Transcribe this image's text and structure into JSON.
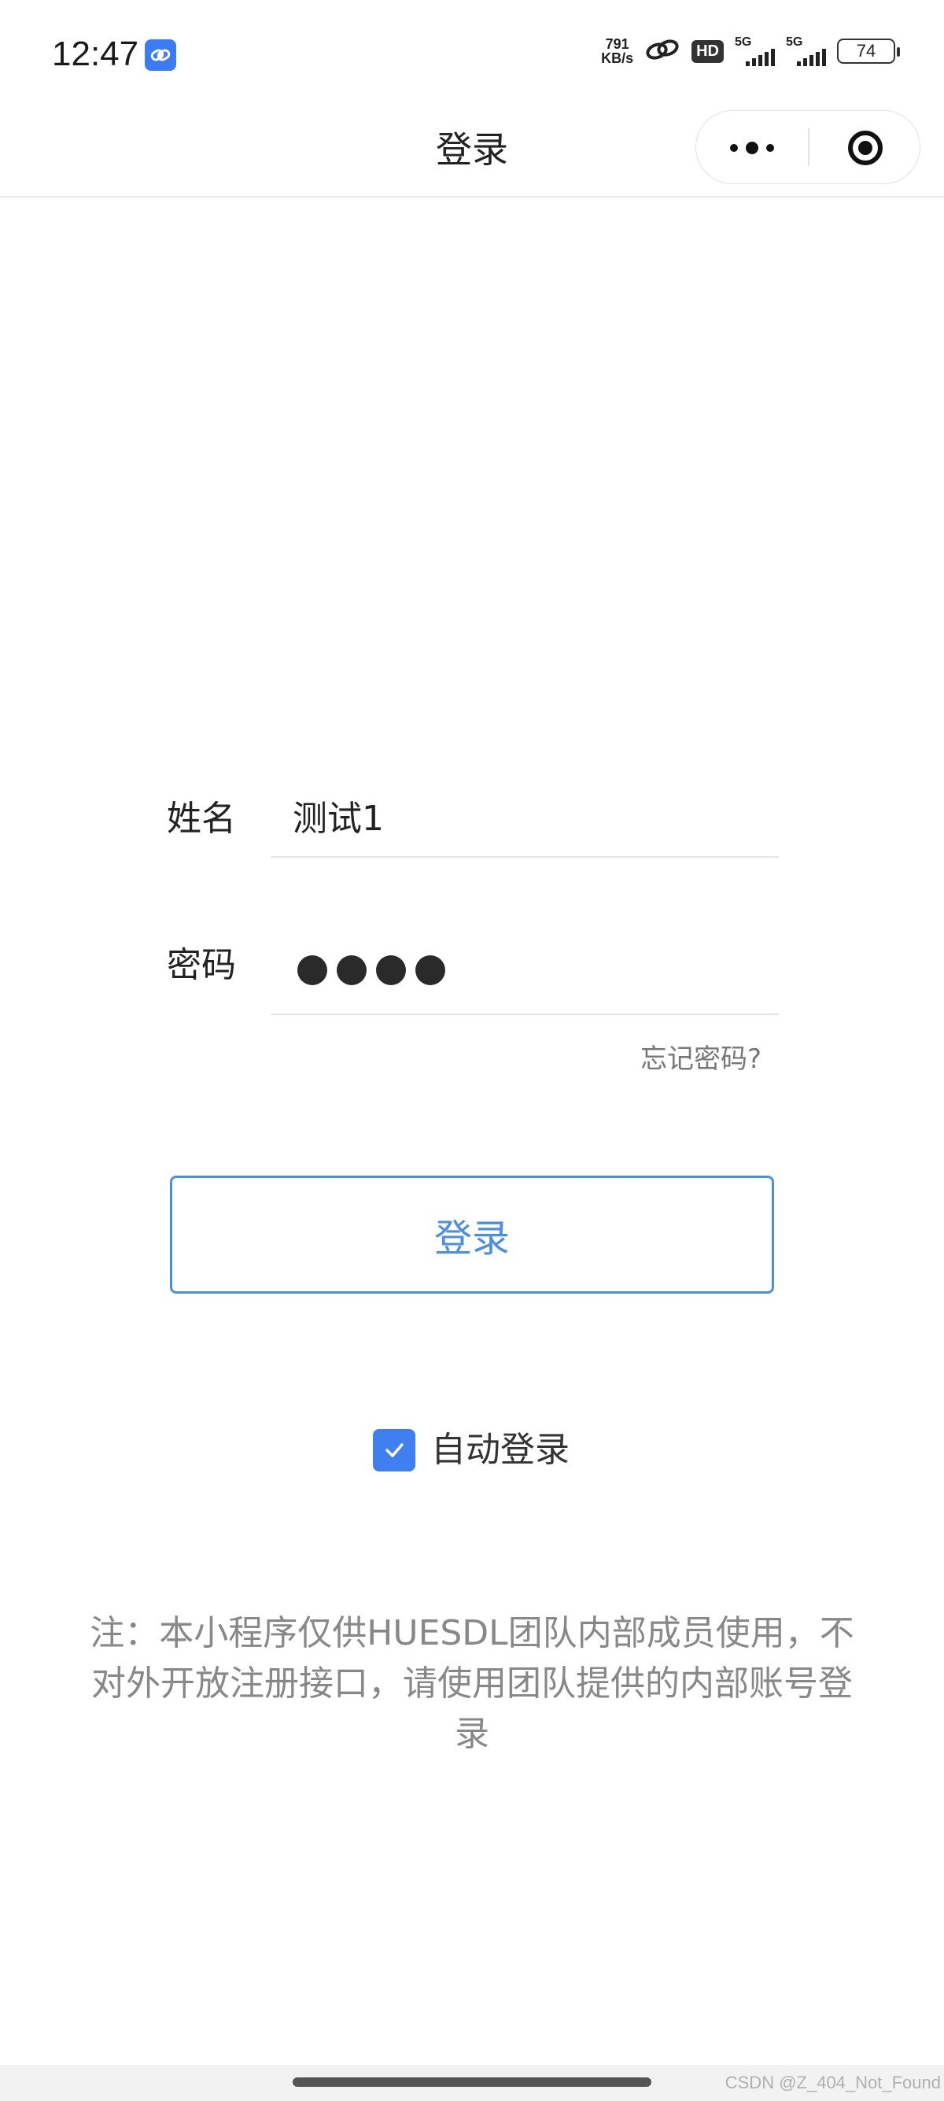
{
  "status_bar": {
    "time": "12:47",
    "app_icon": "link-icon",
    "net_speed_value": "791",
    "net_speed_unit": "KB/s",
    "hd_label": "HD",
    "signal1_label": "5G",
    "signal2_label": "5G",
    "battery": "74"
  },
  "nav": {
    "title": "登录"
  },
  "form": {
    "name_label": "姓名",
    "name_value": "测试1",
    "password_label": "密码",
    "password_masked_count": 4,
    "forgot_label": "忘记密码?"
  },
  "login_button_label": "登录",
  "auto_login": {
    "checked": true,
    "label": "自动登录"
  },
  "notice": "注：本小程序仅供HUESDL团队内部成员使用，不对外开放注册接口，请使用团队提供的内部账号登录",
  "watermark": "CSDN @Z_404_Not_Found",
  "colors": {
    "accent": "#4a8fe2",
    "checkbox": "#3f7ff0",
    "muted_text": "#888888"
  }
}
